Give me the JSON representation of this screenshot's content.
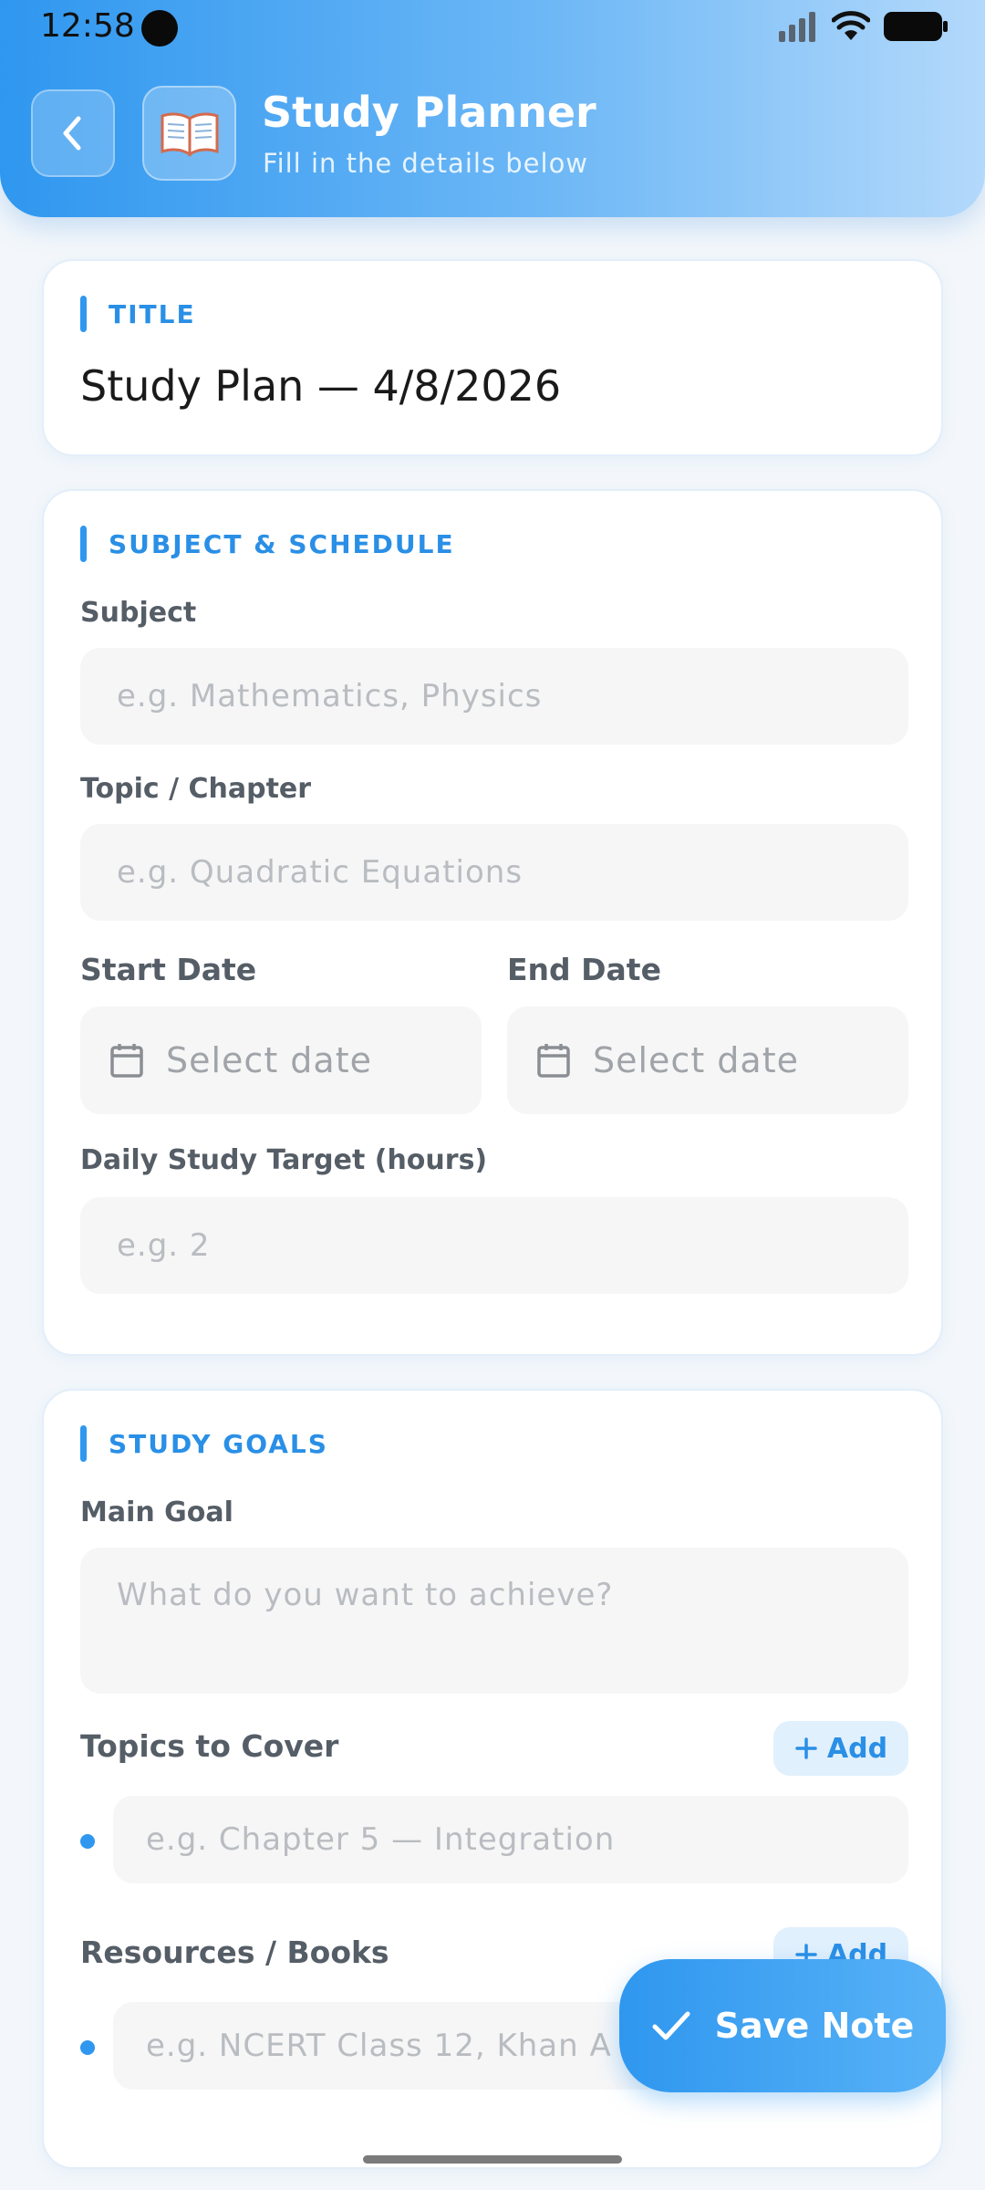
{
  "status_bar": {
    "time": "12:58"
  },
  "header": {
    "title": "Study Planner",
    "subtitle": "Fill in the details below",
    "app_icon": "open-book-icon",
    "back_icon": "chevron-left-icon"
  },
  "title_section": {
    "label": "TITLE",
    "value": "Study Plan — 4/8/2026"
  },
  "schedule_section": {
    "label": "SUBJECT & SCHEDULE",
    "subject_label": "Subject",
    "subject_placeholder": "e.g. Mathematics, Physics",
    "topic_label": "Topic / Chapter",
    "topic_placeholder": "e.g. Quadratic Equations",
    "start_label": "Start Date",
    "start_placeholder": "Select date",
    "end_label": "End Date",
    "end_placeholder": "Select date",
    "target_label": "Daily Study Target (hours)",
    "target_placeholder": "e.g. 2"
  },
  "goals_section": {
    "label": "STUDY GOALS",
    "main_goal_label": "Main Goal",
    "main_goal_placeholder": "What do you want to achieve?",
    "topics_label": "Topics to Cover",
    "topics_add": "Add",
    "topic_item_placeholder": "e.g. Chapter 5 — Integration",
    "resources_label": "Resources / Books",
    "resources_add": "Add",
    "resource_item_placeholder": "e.g. NCERT Class 12, Khan A"
  },
  "save_button": {
    "label": "Save Note"
  },
  "colors": {
    "accent": "#2f97ef",
    "accent_text": "#2a8fe6",
    "background": "#f3f7fb"
  }
}
